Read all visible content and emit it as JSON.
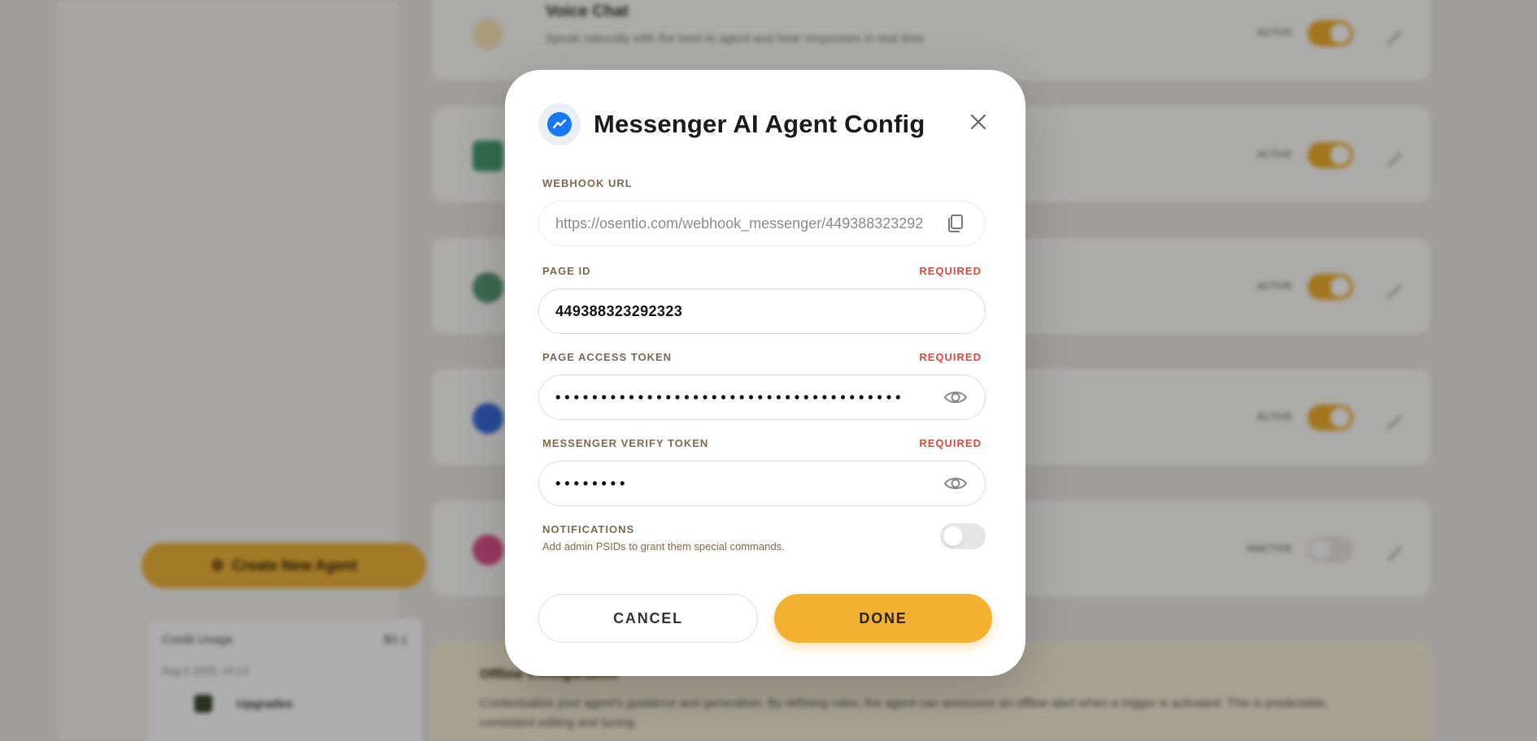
{
  "background": {
    "create_button_label": "Create New Agent",
    "credit": {
      "label": "Credit Usage",
      "value": "$0.1",
      "date": "Aug 5 2025, 15:13",
      "upgrade_label": "Upgrades"
    },
    "cards": [
      {
        "title": "Voice Chat",
        "description": "Speak naturally with the best AI agent and hear responses in real time",
        "status": "ACTIVE",
        "icon_color": "#f5c96b",
        "on": true
      },
      {
        "title": "",
        "description": "",
        "status": "ACTIVE",
        "icon_color": "#4aa07a",
        "on": true
      },
      {
        "title": "",
        "description": "",
        "status": "ACTIVE",
        "icon_color": "#5c9a7c",
        "on": true
      },
      {
        "title": "",
        "description": "",
        "status": "ACTIVE",
        "icon_color": "#3a6ee0",
        "on": true
      },
      {
        "title": "",
        "description": "",
        "status": "INACTIVE",
        "icon_color": "#e0548e",
        "on": false
      }
    ],
    "info": {
      "title": "Offline Configuration",
      "description": "Contextualize your agent's guidance and generation. By defining roles, the agent can announce an offline alert when a trigger is activated. This is predictable, consistent editing and tuning."
    }
  },
  "modal": {
    "title": "Messenger AI Agent Config",
    "logo_icon": "messenger-icon",
    "brand_color": "#1877f2",
    "accent_color": "#f4b030",
    "webhook": {
      "label": "WEBHOOK URL",
      "value": "https://osentio.com/webhook_messenger/449388323292"
    },
    "page_id": {
      "label": "PAGE ID",
      "required": "REQUIRED",
      "value": "449388323292323"
    },
    "access_token": {
      "label": "PAGE ACCESS TOKEN",
      "required": "REQUIRED",
      "masked": "••••••••••••••••••••••••••••••••••••••"
    },
    "verify_token": {
      "label": "MESSENGER VERIFY TOKEN",
      "required": "REQUIRED",
      "masked": "••••••••"
    },
    "notifications": {
      "title": "NOTIFICATIONS",
      "subtitle": "Add admin PSIDs to grant them special commands.",
      "enabled": false
    },
    "cancel_label": "CANCEL",
    "done_label": "DONE"
  }
}
